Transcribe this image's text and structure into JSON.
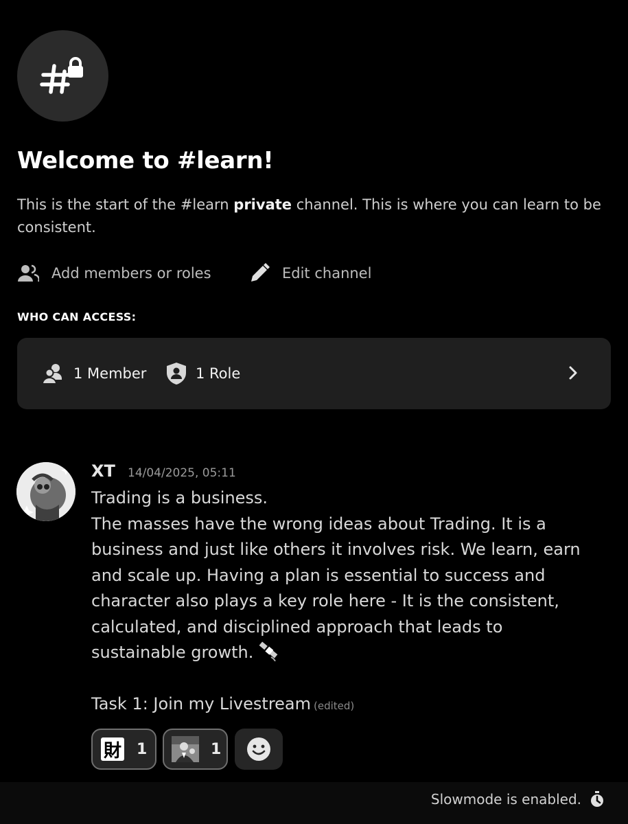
{
  "channel": {
    "icon": "hashtag-lock-icon",
    "welcome_title": "Welcome to #learn!",
    "desc_part1": "This is the start of the #learn ",
    "desc_bold": "private",
    "desc_part2": " channel. This is where you can learn to be consistent."
  },
  "actions": {
    "add_members_label": "Add members or roles",
    "add_members_icon": "add-members-icon",
    "edit_channel_label": "Edit channel",
    "edit_channel_icon": "pencil-icon"
  },
  "access": {
    "heading": "WHO CAN ACCESS:",
    "members_label": "1 Member",
    "roles_label": "1 Role"
  },
  "message": {
    "author": "XT",
    "timestamp": "14/04/2025, 05:11",
    "lines": [
      "Trading is a business.",
      "The masses have the wrong ideas about Trading. It is a business and just like others it involves risk. We learn, earn and scale up. Having a plan is essential to success and character also plays a key role here - It is the consistent, calculated, and disciplined approach that leads to sustainable growth."
    ],
    "task_line": "Task 1: Join my Livestream",
    "edited_label": "(edited)",
    "reactions": [
      {
        "emoji_text": "財",
        "count": "1"
      },
      {
        "emoji_icon": "person-photo-emoji",
        "count": "1"
      }
    ]
  },
  "footer": {
    "slowmode_text": "Slowmode is enabled.",
    "slowmode_icon": "stopwatch-icon"
  }
}
